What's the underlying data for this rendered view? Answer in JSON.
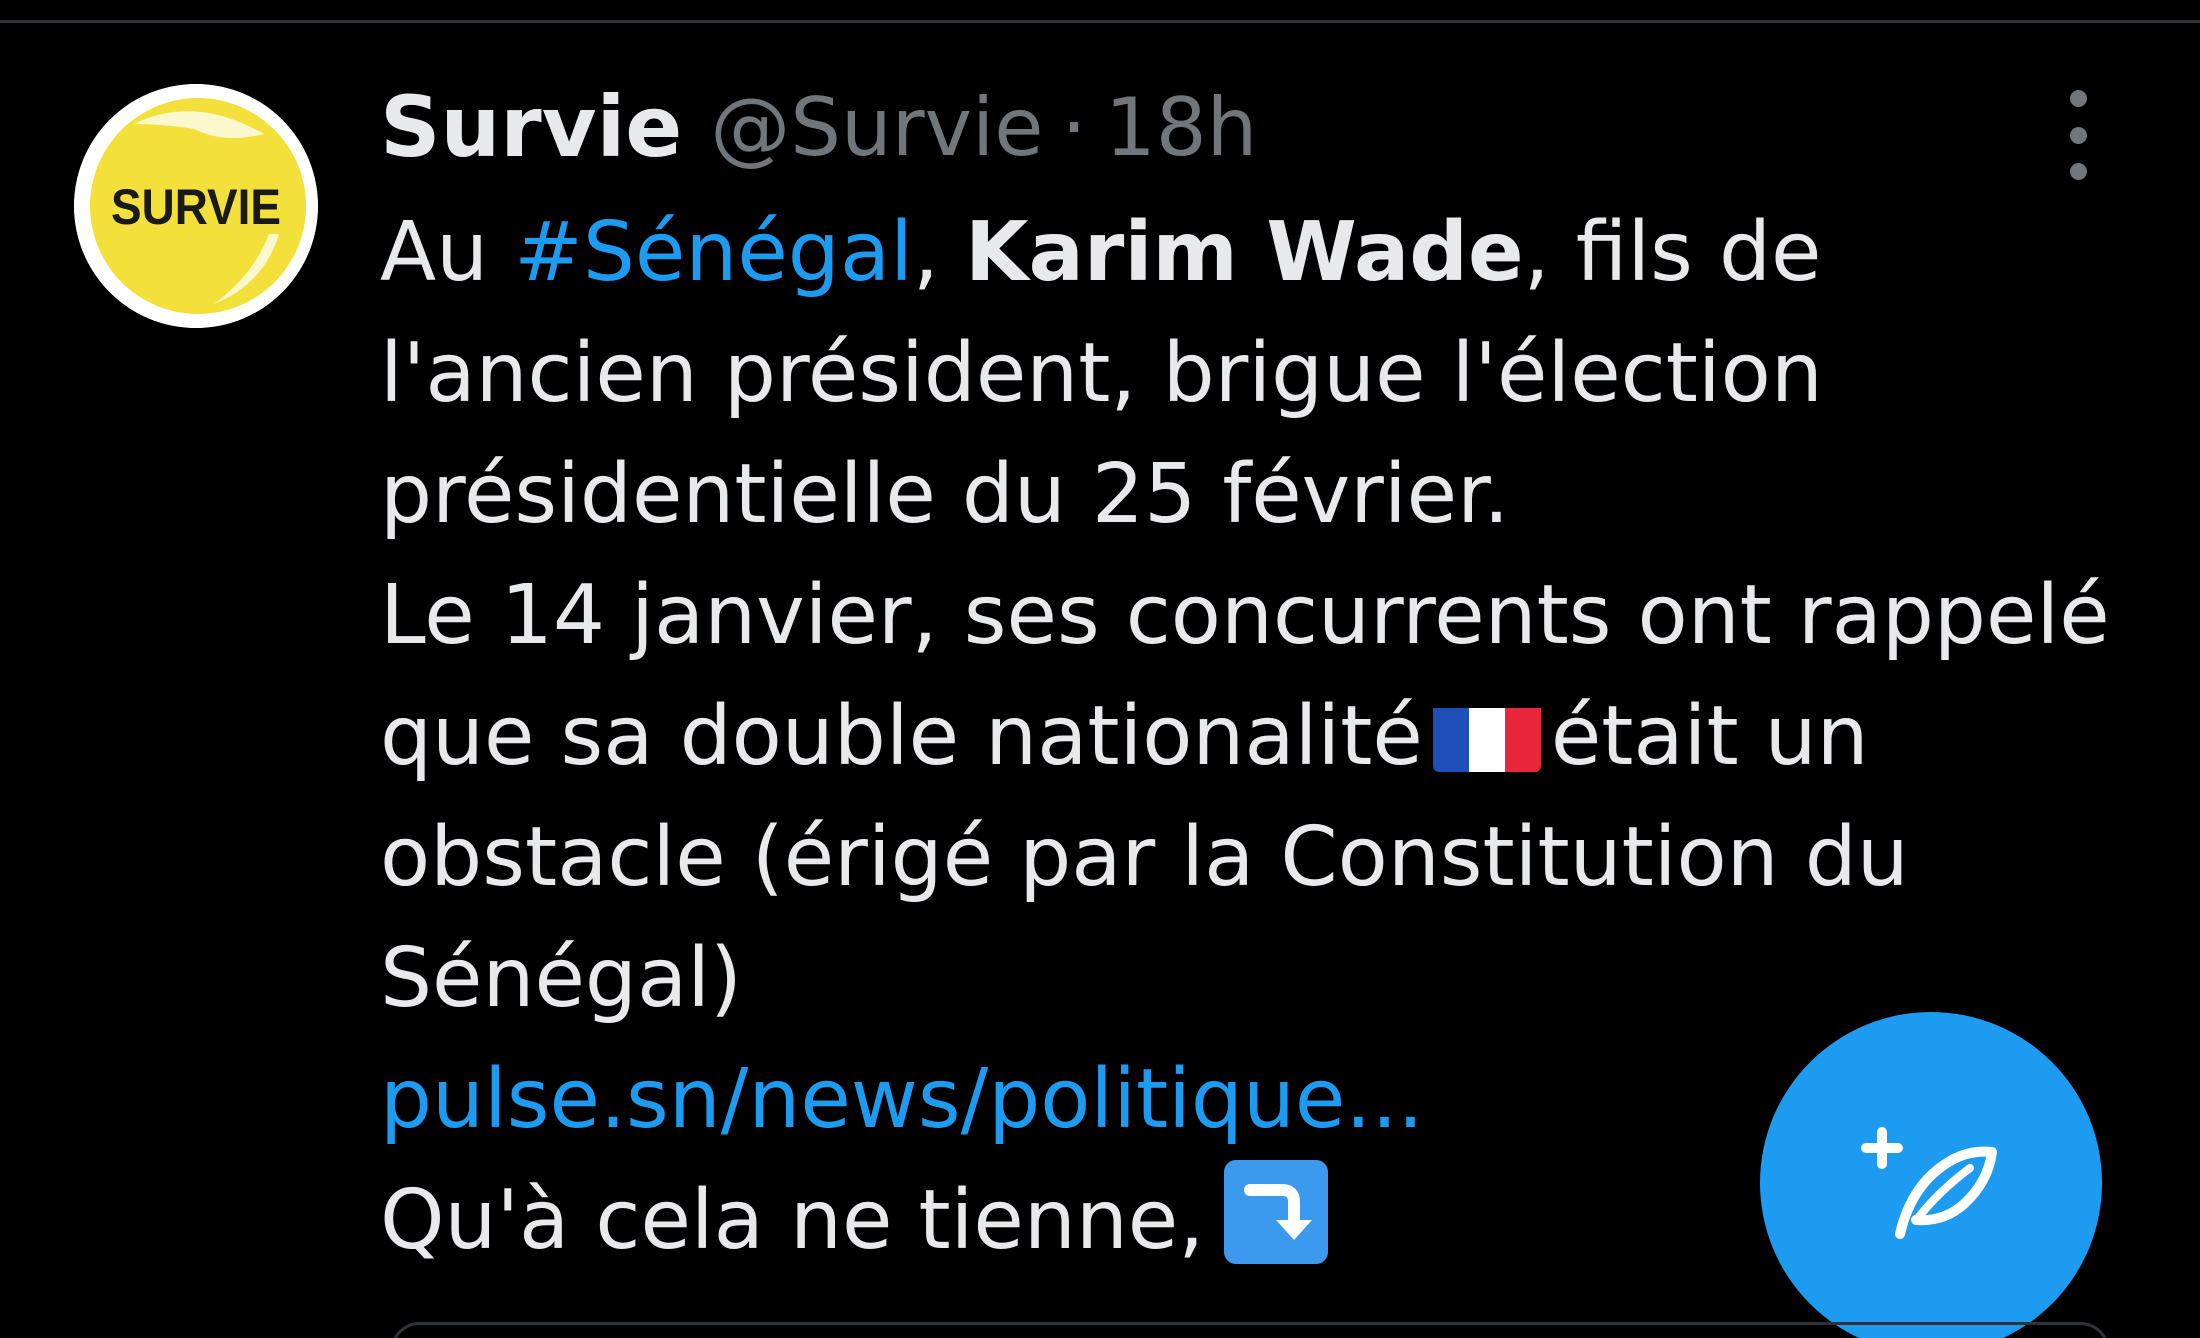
{
  "tweet": {
    "author_name": "Survie",
    "handle": "@Survie",
    "separator": "·",
    "timestamp": "18h",
    "avatar_text": "SURVIE",
    "lines": {
      "l1_pre": "Au ",
      "l1_hashtag": "#Sénégal",
      "l1_mid": ", ",
      "l1_bold": "Karim Wade",
      "l1_post": ", fils de",
      "l2": "l'ancien président, brigue l'élection",
      "l3": "présidentielle du 25 février.",
      "l4": "Le 14 janvier, ses concurrents ont rappelé",
      "l5_pre": "que sa double nationalité",
      "l5_post": "était un",
      "l6": "obstacle (érigé par la Constitution du",
      "l7": "Sénégal)",
      "l8_link": "pulse.sn/news/politique...",
      "l9": "Qu'à cela ne tienne,"
    }
  },
  "icons": {
    "more": "more-vertical-icon",
    "compose": "compose-tweet-icon",
    "flag": "flag-france-emoji",
    "arrow": "right-arrow-curving-down-emoji"
  },
  "colors": {
    "background": "#000000",
    "text_primary": "#e7e9ea",
    "text_secondary": "#71767b",
    "accent": "#1d9bf0",
    "avatar_yellow": "#f4e03a"
  }
}
